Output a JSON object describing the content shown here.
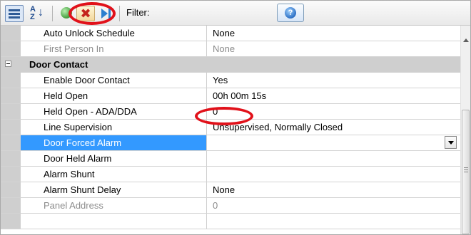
{
  "toolbar": {
    "filter_label": "Filter:",
    "buttons": [
      {
        "id": "categorized",
        "icon": "categorized-view-icon"
      },
      {
        "id": "alphabetical",
        "icon": "sort-alphabetical-icon",
        "glyph_a": "A",
        "glyph_z": "Z",
        "glyph_arrow": "↓"
      },
      {
        "id": "status",
        "icon": "green-status-icon"
      },
      {
        "id": "remove",
        "icon": "red-x-icon",
        "glyph": "✖"
      },
      {
        "id": "play",
        "icon": "play-bar-icon"
      },
      {
        "id": "help",
        "icon": "help-icon",
        "glyph": "?"
      }
    ]
  },
  "grid": {
    "rows": [
      {
        "type": "property",
        "name": "Auto Unlock Schedule",
        "value": "None",
        "disabled": false
      },
      {
        "type": "property",
        "name": "First Person In",
        "value": "None",
        "disabled": true
      },
      {
        "type": "category",
        "name": "Door Contact"
      },
      {
        "type": "property",
        "name": "Enable Door Contact",
        "value": "Yes",
        "disabled": false
      },
      {
        "type": "property",
        "name": "Held Open",
        "value": "00h 00m 15s",
        "disabled": false
      },
      {
        "type": "property",
        "name": "Held Open - ADA/DDA",
        "value": "0",
        "disabled": false
      },
      {
        "type": "property",
        "name": "Line Supervision",
        "value": "Unsupervised, Normally Closed",
        "disabled": false
      },
      {
        "type": "property",
        "name": "Door Forced Alarm",
        "value": "",
        "disabled": false,
        "selected": true
      },
      {
        "type": "property",
        "name": "Door Held Alarm",
        "value": "",
        "disabled": false
      },
      {
        "type": "property",
        "name": "Alarm Shunt",
        "value": "",
        "disabled": false
      },
      {
        "type": "property",
        "name": "Alarm Shunt Delay",
        "value": "None",
        "disabled": false
      },
      {
        "type": "property",
        "name": "Panel Address",
        "value": "0",
        "disabled": true
      }
    ]
  },
  "colors": {
    "selection": "#3399ff",
    "annotation": "#e1111a",
    "gutter": "#cfcfcf"
  }
}
